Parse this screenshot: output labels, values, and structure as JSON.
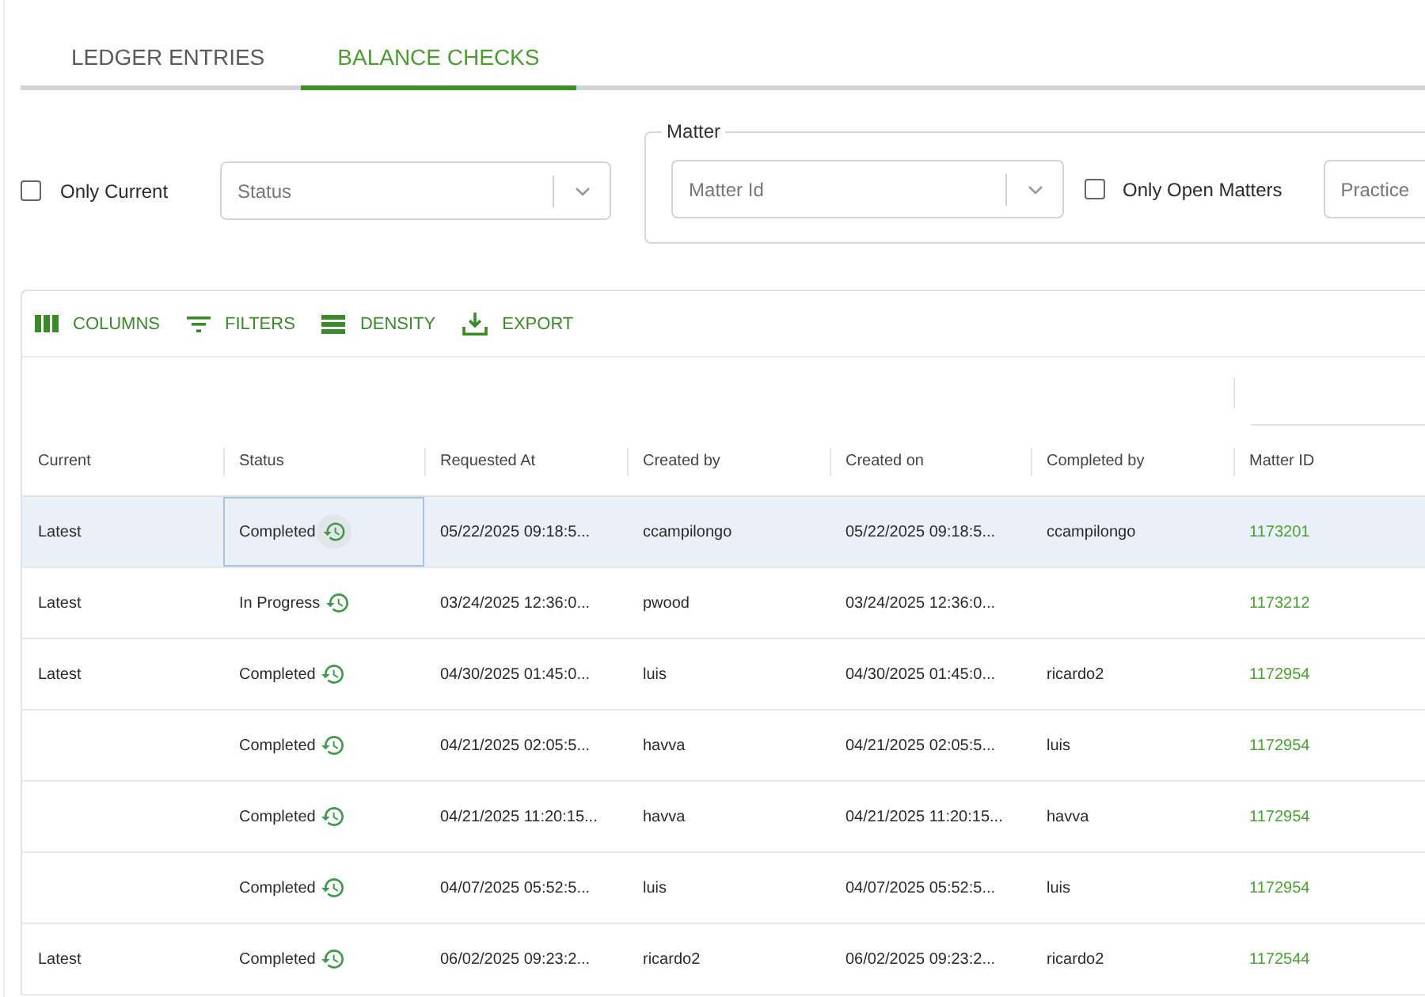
{
  "tabs": [
    {
      "label": "LEDGER ENTRIES",
      "selected": false
    },
    {
      "label": "BALANCE CHECKS",
      "selected": true
    }
  ],
  "filters": {
    "only_current": {
      "label": "Only Current",
      "checked": false
    },
    "status": {
      "placeholder": "Status"
    },
    "matter": {
      "legend": "Matter",
      "matter_id": {
        "placeholder": "Matter Id"
      },
      "only_open_matters": {
        "label": "Only Open Matters",
        "checked": false
      },
      "practice": {
        "placeholder": "Practice"
      }
    }
  },
  "grid": {
    "toolbar": [
      {
        "kind": "columns",
        "label": "COLUMNS"
      },
      {
        "kind": "filters",
        "label": "FILTERS"
      },
      {
        "kind": "density",
        "label": "DENSITY"
      },
      {
        "kind": "export",
        "label": "EXPORT"
      }
    ],
    "columns": [
      "Current",
      "Status",
      "Requested At",
      "Created by",
      "Created on",
      "Completed by",
      "Matter ID"
    ],
    "rows": [
      {
        "current": "Latest",
        "status": "Completed",
        "requested_at": "05/22/2025 09:18:5...",
        "created_by": "ccampilongo",
        "created_on": "05/22/2025 09:18:5...",
        "completed_by": "ccampilongo",
        "matter_id": "1173201",
        "selected": true,
        "focused": true
      },
      {
        "current": "Latest",
        "status": "In Progress",
        "requested_at": "03/24/2025 12:36:0...",
        "created_by": "pwood",
        "created_on": "03/24/2025 12:36:0...",
        "matter_id": "1173212",
        "selected": false,
        "focused": false
      },
      {
        "current": "Latest",
        "status": "Completed",
        "requested_at": "04/30/2025 01:45:0...",
        "created_by": "luis",
        "created_on": "04/30/2025 01:45:0...",
        "completed_by": "ricardo2",
        "matter_id": "1172954",
        "selected": false,
        "focused": false
      },
      {
        "status": "Completed",
        "requested_at": "04/21/2025 02:05:5...",
        "created_by": "havva",
        "created_on": "04/21/2025 02:05:5...",
        "completed_by": "luis",
        "matter_id": "1172954",
        "selected": false,
        "focused": false
      },
      {
        "status": "Completed",
        "requested_at": "04/21/2025 11:20:15...",
        "created_by": "havva",
        "created_on": "04/21/2025 11:20:15...",
        "completed_by": "havva",
        "matter_id": "1172954",
        "selected": false,
        "focused": false
      },
      {
        "status": "Completed",
        "requested_at": "04/07/2025 05:52:5...",
        "created_by": "luis",
        "created_on": "04/07/2025 05:52:5...",
        "completed_by": "luis",
        "matter_id": "1172954",
        "selected": false,
        "focused": false
      },
      {
        "current": "Latest",
        "status": "Completed",
        "requested_at": "06/02/2025 09:23:2...",
        "created_by": "ricardo2",
        "created_on": "06/02/2025 09:23:2...",
        "completed_by": "ricardo2",
        "matter_id": "1172544",
        "selected": false,
        "focused": false
      }
    ]
  }
}
